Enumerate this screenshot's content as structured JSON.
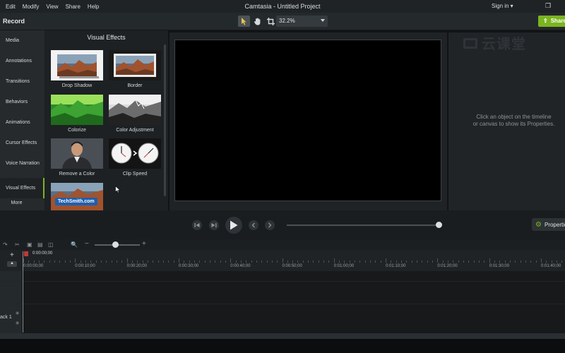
{
  "menu": {
    "items": [
      "Edit",
      "Modify",
      "View",
      "Share",
      "Help"
    ],
    "title": "Camtasia - Untitled Project",
    "signin": "Sign in ▾"
  },
  "toolbar": {
    "record_label": "Record",
    "zoom_value": "32.2%",
    "share_label": "Share",
    "accent_color": "#7bb51f"
  },
  "sidebar": {
    "items": [
      {
        "label": "Media"
      },
      {
        "label": "Annotations"
      },
      {
        "label": "Transitions"
      },
      {
        "label": "Behaviors"
      },
      {
        "label": "Animations"
      },
      {
        "label": "Cursor Effects"
      },
      {
        "label": "Voice Narration"
      },
      {
        "label": "Visual Effects"
      }
    ],
    "more_label": "More"
  },
  "panel": {
    "title": "Visual Effects",
    "effects": [
      {
        "label": "Drop Shadow"
      },
      {
        "label": "Border"
      },
      {
        "label": "Colorize"
      },
      {
        "label": "Color Adjustment"
      },
      {
        "label": "Remove a Color"
      },
      {
        "label": "Clip Speed"
      },
      {
        "label": "",
        "overlay_text": "TechSmith.com"
      }
    ]
  },
  "properties": {
    "hint_line1": "Click an object on the timeline",
    "hint_line2": "or canvas to show its Properties.",
    "button_label": "Properties"
  },
  "watermark": {
    "text": "云课堂"
  },
  "timeline": {
    "playhead_time": "0:00:00;00",
    "ticks": [
      "0:00:00;00",
      "0:00:10;00",
      "0:00:20;00",
      "0:00:30;00",
      "0:00:40;00",
      "0:00:50;00",
      "0:01:00;00",
      "0:01:10;00",
      "0:01:20;00",
      "0:01:30;00",
      "0:01:40;00"
    ],
    "track_label": "ack 1",
    "zoom_level": 0.45
  }
}
